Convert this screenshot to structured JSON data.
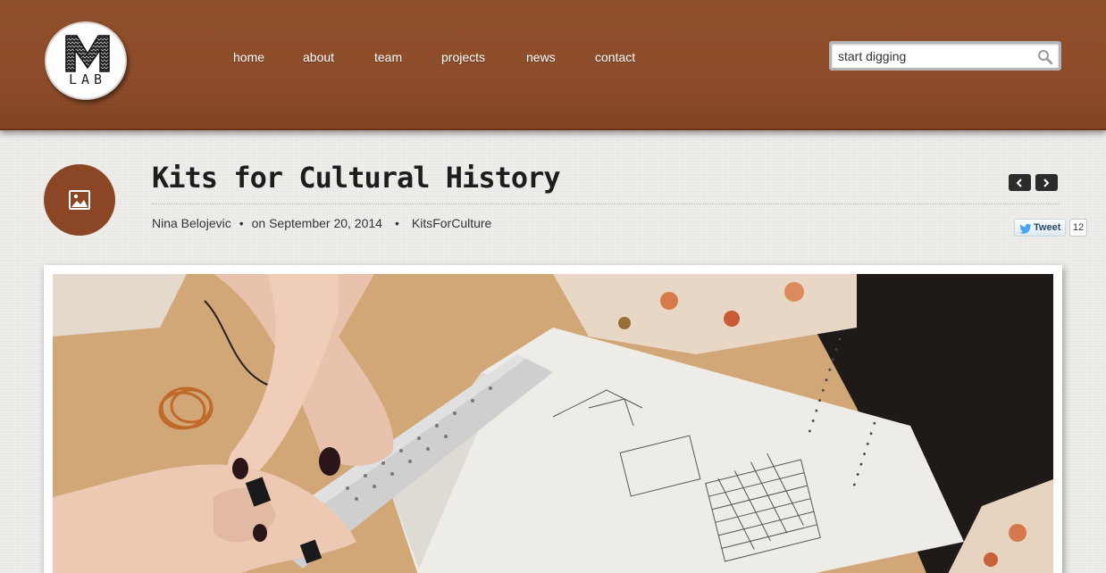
{
  "header": {
    "logo": {
      "letter": "M",
      "text": "LAB"
    },
    "nav": [
      {
        "id": "home",
        "label": "home"
      },
      {
        "id": "about",
        "label": "about"
      },
      {
        "id": "team",
        "label": "team"
      },
      {
        "id": "projects",
        "label": "projects"
      },
      {
        "id": "news",
        "label": "news"
      },
      {
        "id": "contact",
        "label": "contact"
      }
    ],
    "search": {
      "placeholder": "start digging",
      "icon": "search-icon"
    }
  },
  "post": {
    "format_icon": "image-icon",
    "title": "Kits for Cultural History",
    "author": "Nina Belojevic",
    "date": "on September 20, 2014",
    "category": "KitsForCulture",
    "pager": {
      "prev_icon": "chevron-left-icon",
      "next_icon": "chevron-right-icon"
    },
    "share": {
      "tweet_label": "Tweet",
      "tweet_count": "12"
    }
  },
  "colors": {
    "header_brown": "#8a4a26",
    "badge_brown": "#8a4625",
    "page_background": "#ecebe8",
    "pager_dark": "#2c2c2c"
  }
}
